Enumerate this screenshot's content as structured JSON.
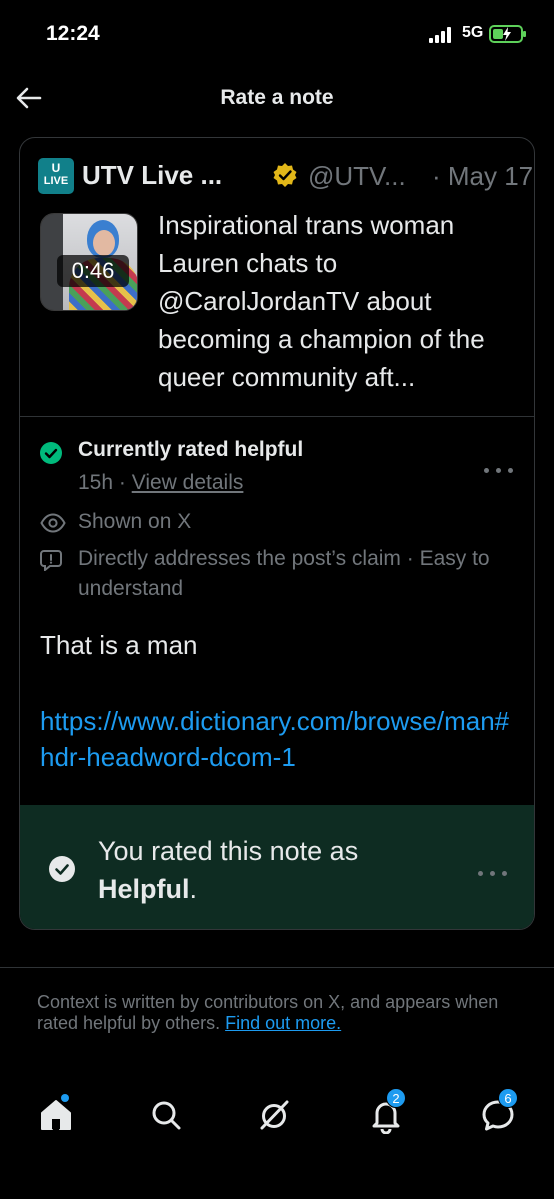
{
  "status_bar": {
    "time": "12:24",
    "network": "5G"
  },
  "header": {
    "title": "Rate a note"
  },
  "post": {
    "logo_top": "U",
    "logo_bottom": "LIVE",
    "author": "UTV Live ...",
    "handle": "@UTV...",
    "date": "· May 17",
    "video_duration": "0:46",
    "text": "Inspirational trans woman Lauren chats to @CarolJordanTV about becoming a champion of the queer community aft..."
  },
  "note": {
    "status_title": "Currently rated helpful",
    "age": "15h · ",
    "view_details": "View details",
    "shown_on": "Shown on X",
    "reasons": "Directly addresses the post’s claim · Easy to understand",
    "text": "That is a man",
    "link": "https://www.dictionary.com/browse/man#hdr-headword-dcom-1",
    "rated_prefix": "You rated this note as",
    "rated_value": "Helpful",
    "rated_suffix": "."
  },
  "footer": {
    "context_text": "Context is written by contributors on X, and appears when rated helpful by others. ",
    "context_link": "Find out more."
  },
  "tabbar": {
    "notifications_badge": "2",
    "messages_badge": "6"
  },
  "colors": {
    "accent": "#1d9bf0",
    "helpful_green": "#00ba7c",
    "rated_bg": "#0e2c22"
  }
}
